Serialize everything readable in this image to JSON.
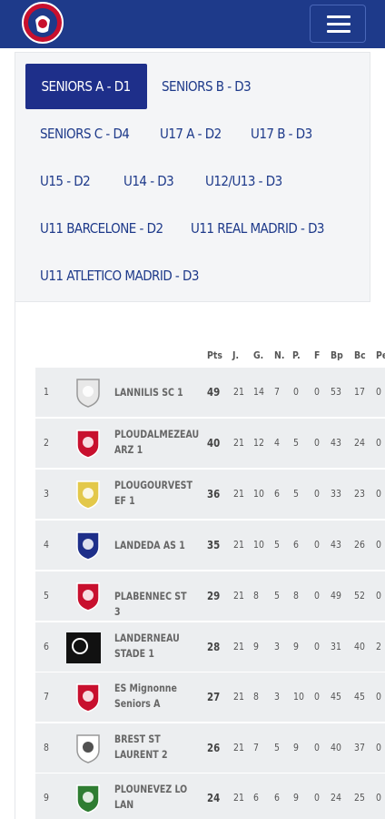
{
  "header": {
    "logo_icon": "club-crest-icon",
    "menu_icon": "hamburger-menu-icon"
  },
  "tabs": [
    {
      "label": "SENIORS A - D1",
      "active": true
    },
    {
      "label": "SENIORS B - D3"
    },
    {
      "label": "SENIORS C - D4"
    },
    {
      "label": "U17 A - D2"
    },
    {
      "label": "U17 B - D3"
    },
    {
      "label": "U15 - D2"
    },
    {
      "label": "U14 - D3"
    },
    {
      "label": "U12/U13 - D3"
    },
    {
      "label": "U11 BARCELONE - D2"
    },
    {
      "label": "U11 REAL MADRID - D3"
    },
    {
      "label": "U11 ATLETICO MADRID - D3"
    }
  ],
  "standings": {
    "columns": [
      "Pts",
      "J.",
      "G.",
      "N.",
      "P.",
      "F",
      "Bp",
      "Bc",
      "Pe"
    ],
    "rows": [
      {
        "rank": "1",
        "team": "LANNILIS SC 1",
        "pts": "49",
        "j": "21",
        "g": "14",
        "n": "7",
        "p": "0",
        "f": "0",
        "bp": "53",
        "bc": "17",
        "pe": "0",
        "crest": "lannilis-crest-icon"
      },
      {
        "rank": "2",
        "team": "PLOUDALMEZEAU ARZ 1",
        "pts": "40",
        "j": "21",
        "g": "12",
        "n": "4",
        "p": "5",
        "f": "0",
        "bp": "43",
        "bc": "24",
        "pe": "0",
        "crest": "ploudalmezeau-crest-icon"
      },
      {
        "rank": "3",
        "team": "PLOUGOURVEST EF 1",
        "pts": "36",
        "j": "21",
        "g": "10",
        "n": "6",
        "p": "5",
        "f": "0",
        "bp": "33",
        "bc": "23",
        "pe": "0",
        "crest": "plougourvest-crest-icon"
      },
      {
        "rank": "4",
        "team": "LANDEDA AS 1",
        "pts": "35",
        "j": "21",
        "g": "10",
        "n": "5",
        "p": "6",
        "f": "0",
        "bp": "43",
        "bc": "26",
        "pe": "0",
        "crest": "landeda-crest-icon"
      },
      {
        "rank": "5",
        "team": "PLABENNEC ST 3",
        "pts": "29",
        "j": "21",
        "g": "8",
        "n": "5",
        "p": "8",
        "f": "0",
        "bp": "49",
        "bc": "52",
        "pe": "0",
        "crest": "plabennec-crest-icon"
      },
      {
        "rank": "6",
        "team": "LANDERNEAU STADE 1",
        "pts": "28",
        "j": "21",
        "g": "9",
        "n": "3",
        "p": "9",
        "f": "0",
        "bp": "31",
        "bc": "40",
        "pe": "2",
        "crest": "landerneau-crest-icon"
      },
      {
        "rank": "7",
        "team": "ES Mignonne Seniors A",
        "pts": "27",
        "j": "21",
        "g": "8",
        "n": "3",
        "p": "10",
        "f": "0",
        "bp": "45",
        "bc": "45",
        "pe": "0",
        "crest": "es-mignonne-crest-icon"
      },
      {
        "rank": "8",
        "team": "BREST ST LAURENT 2",
        "pts": "26",
        "j": "21",
        "g": "7",
        "n": "5",
        "p": "9",
        "f": "0",
        "bp": "40",
        "bc": "37",
        "pe": "0",
        "crest": "brest-st-laurent-crest-icon"
      },
      {
        "rank": "9",
        "team": "PLOUNEVEZ LO LAN",
        "pts": "24",
        "j": "21",
        "g": "6",
        "n": "6",
        "p": "9",
        "f": "0",
        "bp": "24",
        "bc": "25",
        "pe": "0",
        "crest": "plounevez-crest-icon"
      }
    ]
  },
  "colors": {
    "brand": "#1e3a8a",
    "active_tab": "#1e2f8a",
    "row_bg": "#eceef0"
  }
}
